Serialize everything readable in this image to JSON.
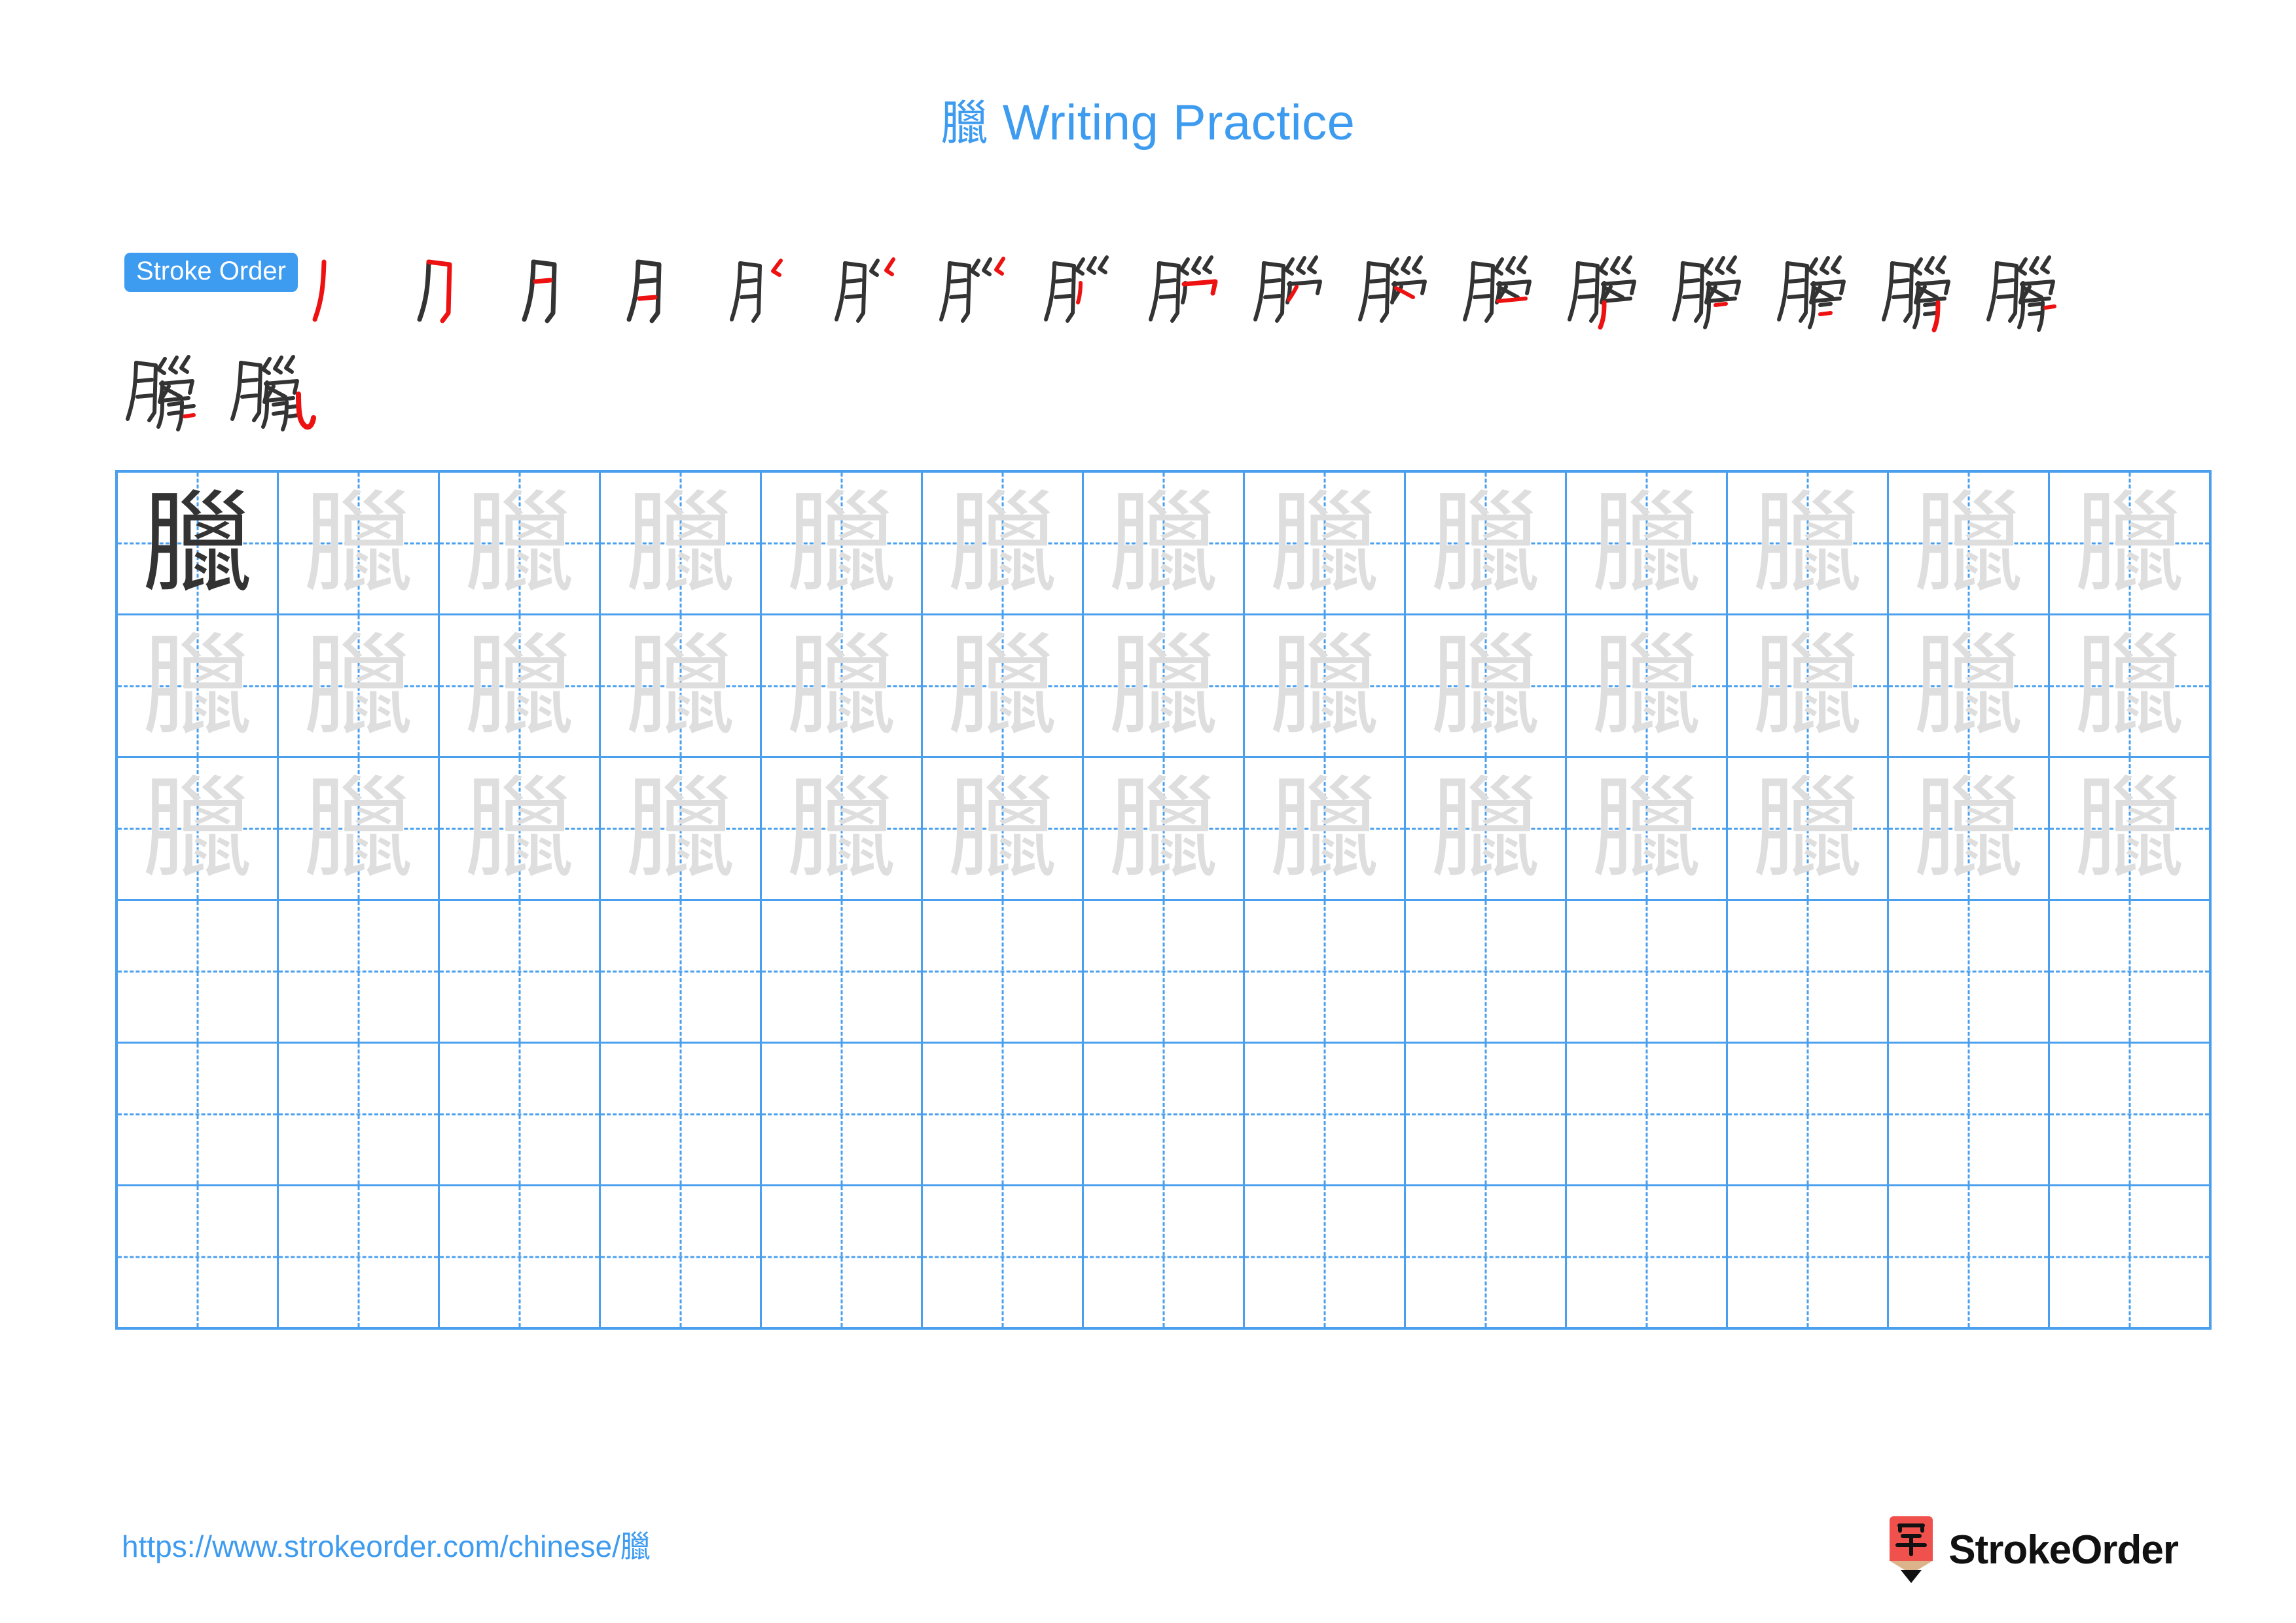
{
  "character": "臘",
  "header": {
    "title_char": "臘",
    "title_text": "Writing Practice"
  },
  "stroke_order": {
    "badge_label": "Stroke Order",
    "total_strokes": 19,
    "new_stroke_color": "#ee1111",
    "existing_stroke_color": "#333333",
    "row1_count": 17,
    "row2_count": 2,
    "frames": [
      {
        "index": 1,
        "partial": "丿"
      },
      {
        "index": 2,
        "partial": "刀"
      },
      {
        "index": 3,
        "partial": "月"
      },
      {
        "index": 4,
        "partial": "月"
      },
      {
        "index": 5,
        "partial": "月丶"
      },
      {
        "index": 6,
        "partial": "月巜"
      },
      {
        "index": 7,
        "partial": "月巛"
      },
      {
        "index": 8,
        "partial": "月巛丿"
      },
      {
        "index": 9,
        "partial": "臘"
      },
      {
        "index": 10,
        "partial": "臘"
      },
      {
        "index": 11,
        "partial": "臘"
      },
      {
        "index": 12,
        "partial": "臘"
      },
      {
        "index": 13,
        "partial": "臘"
      },
      {
        "index": 14,
        "partial": "臘"
      },
      {
        "index": 15,
        "partial": "臘"
      },
      {
        "index": 16,
        "partial": "臘"
      },
      {
        "index": 17,
        "partial": "臘"
      },
      {
        "index": 18,
        "partial": "臘"
      },
      {
        "index": 19,
        "partial": "臘"
      }
    ]
  },
  "practice_grid": {
    "columns": 13,
    "rows": 6,
    "guide_char": "臘",
    "grid_line_color": "#4a9fee",
    "model_char_color": "#333333",
    "trace_char_color": "#dedede",
    "row_modes": [
      "model-then-trace",
      "trace",
      "trace",
      "empty",
      "empty",
      "empty"
    ]
  },
  "footer": {
    "url_prefix": "https://www.strokeorder.com/chinese/",
    "url_char": "臘",
    "brand_name": "StrokeOrder",
    "logo_body_color": "#f0514c",
    "logo_wood_color": "#dcb48c",
    "logo_tip_color": "#111111",
    "logo_glyph": "字"
  }
}
